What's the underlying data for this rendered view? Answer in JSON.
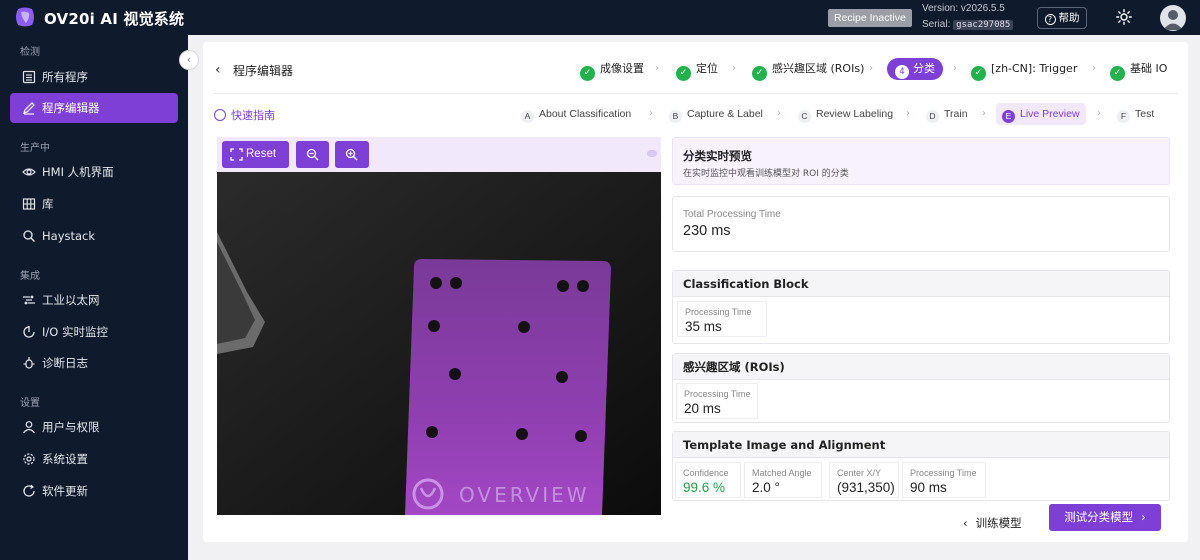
{
  "header": {
    "app_title": "OV20i AI 视觉系统",
    "recipe_status": "Recipe Inactive",
    "version_text": "Version: v2026.5.5",
    "serial_label": "Serial:",
    "serial_value": "gsac297085",
    "help_label": "帮助",
    "theme_icon": "sun-icon",
    "user_icon": "avatar-icon"
  },
  "sidebar": {
    "sections": [
      {
        "label": "检测",
        "items": [
          {
            "label": "所有程序",
            "icon": "list-icon"
          },
          {
            "label": "程序编辑器",
            "icon": "edit-icon",
            "active": true
          }
        ]
      },
      {
        "label": "生产中",
        "items": [
          {
            "label": "HMI 人机界面",
            "icon": "eye-icon"
          },
          {
            "label": "库",
            "icon": "grid-icon"
          },
          {
            "label": "Haystack",
            "icon": "search-icon"
          }
        ]
      },
      {
        "label": "集成",
        "items": [
          {
            "label": "工业以太网",
            "icon": "network-icon"
          },
          {
            "label": "I/O 实时监控",
            "icon": "io-icon"
          },
          {
            "label": "诊断日志",
            "icon": "bug-icon"
          }
        ]
      },
      {
        "label": "设置",
        "items": [
          {
            "label": "用户与权限",
            "icon": "user-icon"
          },
          {
            "label": "系统设置",
            "icon": "gear-icon"
          },
          {
            "label": "软件更新",
            "icon": "refresh-icon"
          }
        ]
      }
    ]
  },
  "editor": {
    "title": "程序编辑器",
    "steps": [
      {
        "label": "成像设置",
        "state": "done"
      },
      {
        "label": "定位",
        "state": "done"
      },
      {
        "label": "感兴趣区域 (ROIs)",
        "state": "done"
      },
      {
        "number": "4",
        "label": "分类",
        "state": "current"
      },
      {
        "label": "[zh-CN]: Trigger",
        "state": "done"
      },
      {
        "label": "基础 IO",
        "state": "done"
      }
    ],
    "guide_label": "快速指南",
    "substeps": [
      {
        "letter": "A",
        "label": "About Classification"
      },
      {
        "letter": "B",
        "label": "Capture & Label"
      },
      {
        "letter": "C",
        "label": "Review Labeling"
      },
      {
        "letter": "D",
        "label": "Train"
      },
      {
        "letter": "E",
        "label": "Live Preview",
        "current": true
      },
      {
        "letter": "F",
        "label": "Test"
      }
    ]
  },
  "viewer": {
    "reset_label": "Reset",
    "zoom_out_icon": "zoom-out-icon",
    "zoom_in_icon": "zoom-in-icon",
    "brand_text": "OVERVIEW",
    "brand_color": "#b57ad9",
    "part_color": "#8f3fb0"
  },
  "preview": {
    "title": "分类实时预览",
    "subtitle": "在实时监控中观看训练模型对 ROI 的分类",
    "total_label": "Total Processing Time",
    "total_value": "230 ms",
    "classification_block": {
      "title": "Classification Block",
      "time_label": "Processing Time",
      "time_value": "35 ms"
    },
    "roi_block": {
      "title": "感兴趣区域 (ROIs)",
      "time_label": "Processing Time",
      "time_value": "20 ms"
    },
    "template_block": {
      "title": "Template Image and Alignment",
      "metrics": [
        {
          "label": "Confidence",
          "value": "99.6 %",
          "color": "#22a04a"
        },
        {
          "label": "Matched Angle",
          "value": "2.0 °"
        },
        {
          "label": "Center X/Y",
          "value": "(931,350)"
        },
        {
          "label": "Processing Time",
          "value": "90 ms"
        }
      ]
    }
  },
  "footer": {
    "prev_label": "训练模型",
    "next_label": "测试分类模型"
  },
  "colors": {
    "accent": "#7e3fd6",
    "sidebar_bg": "#0f1a2c",
    "success": "#22b14c"
  }
}
